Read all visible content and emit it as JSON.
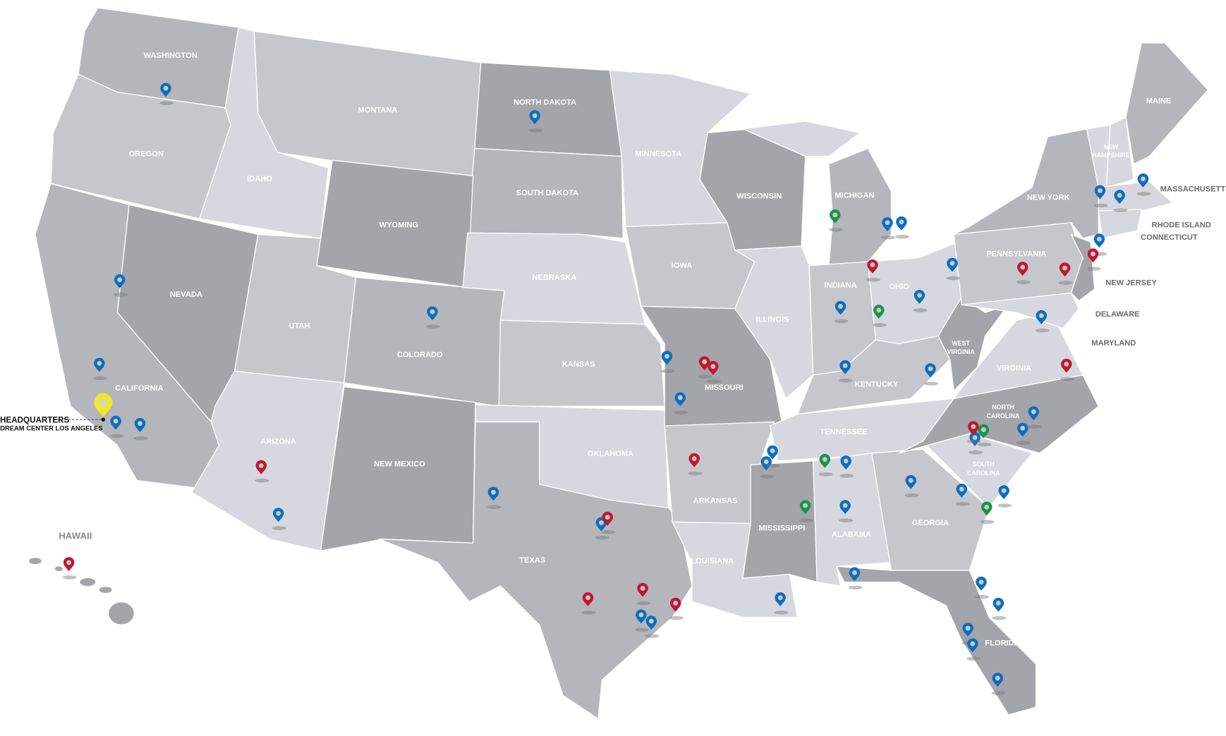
{
  "map": {
    "colors": {
      "light": "#d7d7df",
      "lightmid": "#c6c6cd",
      "mid": "#b5b5bc",
      "dark": "#a4a4ab",
      "ocean": "#ffffff"
    },
    "pin_colors": {
      "blue": "#0a6fbd",
      "red": "#c3162f",
      "green": "#199447",
      "yellow": "#f2e829"
    },
    "labels": {
      "WA": "WASHINGTON",
      "OR": "OREGON",
      "ID": "IDAHO",
      "MT": "MONTANA",
      "ND": "NORTH DAKOTA",
      "SD": "SOUTH DAKOTA",
      "WY": "WYOMING",
      "NV": "NEVADA",
      "CA": "CALIFORNIA",
      "UT": "UTAH",
      "CO": "COLORADO",
      "AZ": "ARIZONA",
      "NM": "NEW MEXICO",
      "NE": "NEBRASKA",
      "KS": "KANSAS",
      "OK": "OKLAHOMA",
      "TX": "TEXAS",
      "MN": "MINNESOTA",
      "IA": "IOWA",
      "MO": "MISSOURI",
      "AR": "ARKANSAS",
      "LA": "LOUISIANA",
      "WI": "WISCONSIN",
      "IL": "ILLINOIS",
      "MI": "MICHIGAN",
      "IN": "INDIANA",
      "OH": "OHIO",
      "KY": "KENTUCKY",
      "TN": "TENNESSEE",
      "MS": "MISSISSIPPI",
      "AL": "ALABAMA",
      "GA": "GEORGIA",
      "FL": "FLORIDA",
      "SC1": "SOUTH",
      "SC2": "CAROLINA",
      "NC1": "NORTH",
      "NC2": "CAROLINA",
      "VA": "VIRGINIA",
      "WV1": "WEST",
      "WV2": "VIRGINIA",
      "PA": "PENNSYLVANIA",
      "NY": "NEW YORK",
      "NH1": "NEW",
      "NH2": "HAMPSHIRE",
      "ME": "MAINE",
      "MA": "MASSACHUSETTS",
      "RI": "RHODE ISLAND",
      "CT": "CONNECTICUT",
      "NJ": "NEW JERSEY",
      "DE": "DELAWARE",
      "MD": "MARYLAND",
      "HI": "HAWAII"
    },
    "headquarters": {
      "title": "HEADQUARTERS",
      "name": "DREAM CENTER LOS ANGELES"
    }
  }
}
